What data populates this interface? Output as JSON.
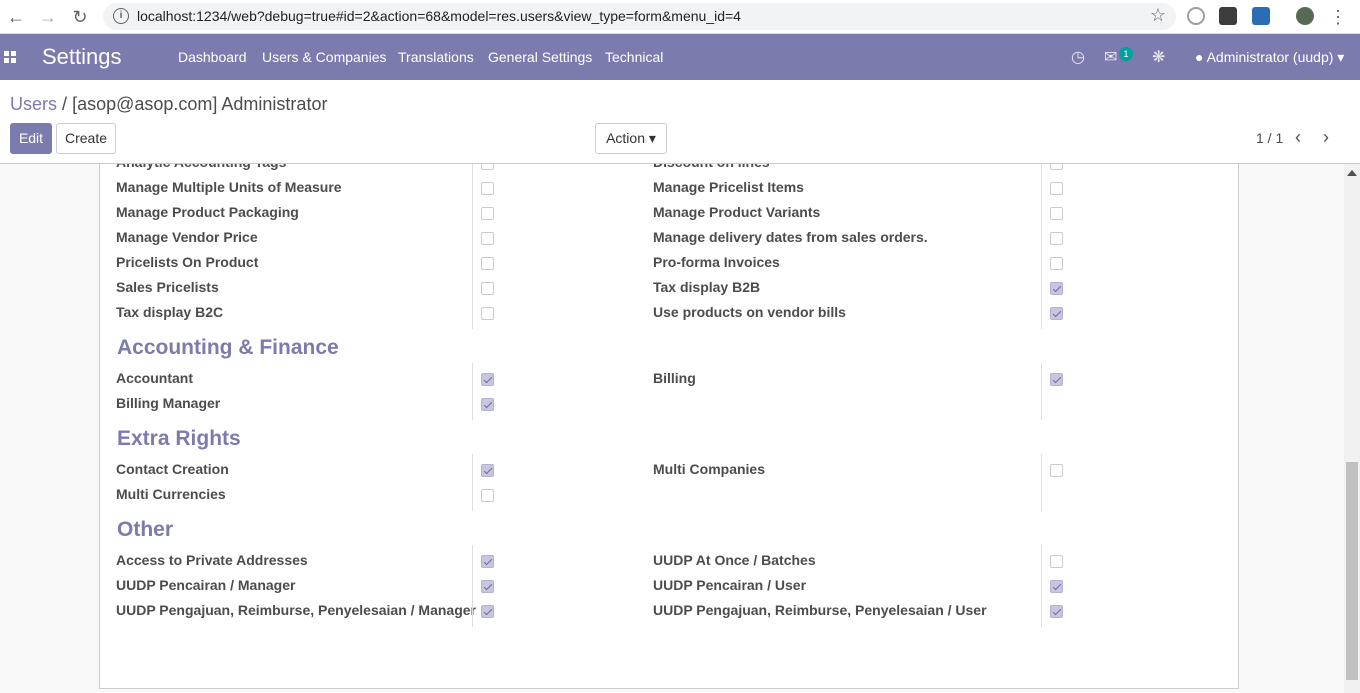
{
  "browser": {
    "url": "localhost:1234/web?debug=true#id=2&action=68&model=res.users&view_type=form&menu_id=4"
  },
  "navbar": {
    "app_title": "Settings",
    "menu": [
      "Dashboard",
      "Users & Companies",
      "Translations",
      "General Settings",
      "Technical"
    ],
    "message_count": "1",
    "user": "Administrator (uudp)"
  },
  "breadcrumb": {
    "parent": "Users",
    "separator": "/",
    "current": "[asop@asop.com] Administrator"
  },
  "buttons": {
    "edit": "Edit",
    "create": "Create",
    "action": "Action"
  },
  "pager": "1 / 1",
  "groups": {
    "top_rows": [
      [
        {
          "label": "Analytic Accounting Tags",
          "checked": false
        },
        {
          "label": "Discount on lines",
          "checked": false
        }
      ],
      [
        {
          "label": "Manage Multiple Units of Measure",
          "checked": false
        },
        {
          "label": "Manage Pricelist Items",
          "checked": false
        }
      ],
      [
        {
          "label": "Manage Product Packaging",
          "checked": false
        },
        {
          "label": "Manage Product Variants",
          "checked": false
        }
      ],
      [
        {
          "label": "Manage Vendor Price",
          "checked": false
        },
        {
          "label": "Manage delivery dates from sales orders.",
          "checked": false
        }
      ],
      [
        {
          "label": "Pricelists On Product",
          "checked": false
        },
        {
          "label": "Pro-forma Invoices",
          "checked": false
        }
      ],
      [
        {
          "label": "Sales Pricelists",
          "checked": false
        },
        {
          "label": "Tax display B2B",
          "checked": true
        }
      ],
      [
        {
          "label": "Tax display B2C",
          "checked": false
        },
        {
          "label": "Use products on vendor bills",
          "checked": true
        }
      ]
    ],
    "sections": [
      {
        "title": "Accounting & Finance",
        "rows": [
          [
            {
              "label": "Accountant",
              "checked": true
            },
            {
              "label": "Billing",
              "checked": true
            }
          ],
          [
            {
              "label": "Billing Manager",
              "checked": true
            },
            null
          ]
        ]
      },
      {
        "title": "Extra Rights",
        "rows": [
          [
            {
              "label": "Contact Creation",
              "checked": true
            },
            {
              "label": "Multi Companies",
              "checked": false
            }
          ],
          [
            {
              "label": "Multi Currencies",
              "checked": false
            },
            null
          ]
        ]
      },
      {
        "title": "Other",
        "rows": [
          [
            {
              "label": "Access to Private Addresses",
              "checked": true
            },
            {
              "label": "UUDP At Once / Batches",
              "checked": false
            }
          ],
          [
            {
              "label": "UUDP Pencairan / Manager",
              "checked": true
            },
            {
              "label": "UUDP Pencairan / User",
              "checked": true
            }
          ],
          [
            {
              "label": "UUDP Pengajuan, Reimburse, Penyelesaian / Manager",
              "checked": true
            },
            {
              "label": "UUDP Pengajuan, Reimburse, Penyelesaian / User",
              "checked": true
            }
          ]
        ]
      }
    ]
  }
}
